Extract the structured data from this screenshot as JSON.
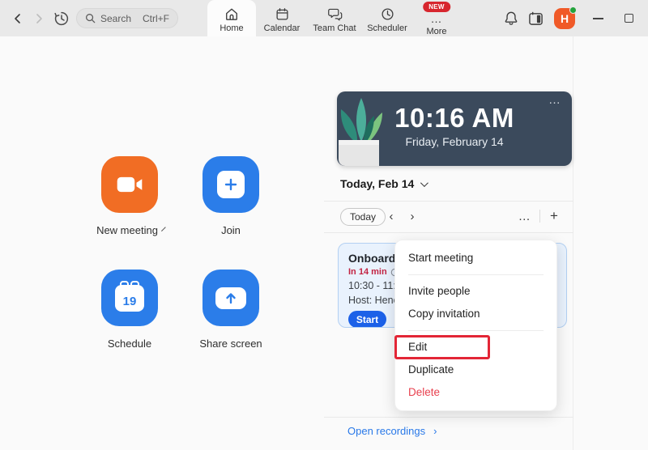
{
  "titlebar": {
    "search": {
      "placeholder": "Search",
      "shortcut": "Ctrl+F"
    },
    "tabs": [
      {
        "label": "Home",
        "active": true
      },
      {
        "label": "Calendar",
        "active": false
      },
      {
        "label": "Team Chat",
        "active": false
      },
      {
        "label": "Scheduler",
        "active": false
      },
      {
        "label": "More",
        "active": false,
        "badge": "NEW"
      }
    ],
    "more_badge": "NEW",
    "avatar_initial": "H"
  },
  "icons": {
    "ellipsis": "…",
    "plus": "+",
    "chevron_left": "‹",
    "chevron_right": "›",
    "link_chevron": "›",
    "more_dots": "…"
  },
  "quick_actions": {
    "new_meeting": {
      "label": "New meeting",
      "color": "#f16d24"
    },
    "join": {
      "label": "Join",
      "color": "#2b7de9"
    },
    "schedule": {
      "label": "Schedule",
      "color": "#2b7de9",
      "date_number": "19"
    },
    "share_screen": {
      "label": "Share screen",
      "color": "#2b7de9"
    }
  },
  "panel": {
    "clock_card": {
      "time": "10:16 AM",
      "date": "Friday, February 14"
    },
    "date_header": "Today, Feb 14",
    "toolbar": {
      "today_button": "Today"
    },
    "meeting": {
      "title": "Onboard",
      "starts_in": "In 14 min",
      "time": "10:30 - 11:",
      "host": "Host: Henc",
      "start_button": "Start"
    },
    "menu": {
      "items": [
        "Start meeting",
        "Invite people",
        "Copy invitation",
        "Edit",
        "Duplicate",
        "Delete"
      ],
      "highlighted_item": "Edit"
    },
    "recordings_link": "Open recordings"
  },
  "colors": {
    "zoom_orange": "#f16d24",
    "action_blue": "#2b7de9",
    "start_blue": "#1c61e8",
    "navy_card": "#3b4a5c",
    "countdown_red": "#c22443",
    "delete_red": "#e8414f",
    "annotation_red": "#e32636",
    "badge_red": "#d7262e",
    "link_blue": "#2878e8",
    "meeting_card_bg": "#e9f2fd"
  }
}
